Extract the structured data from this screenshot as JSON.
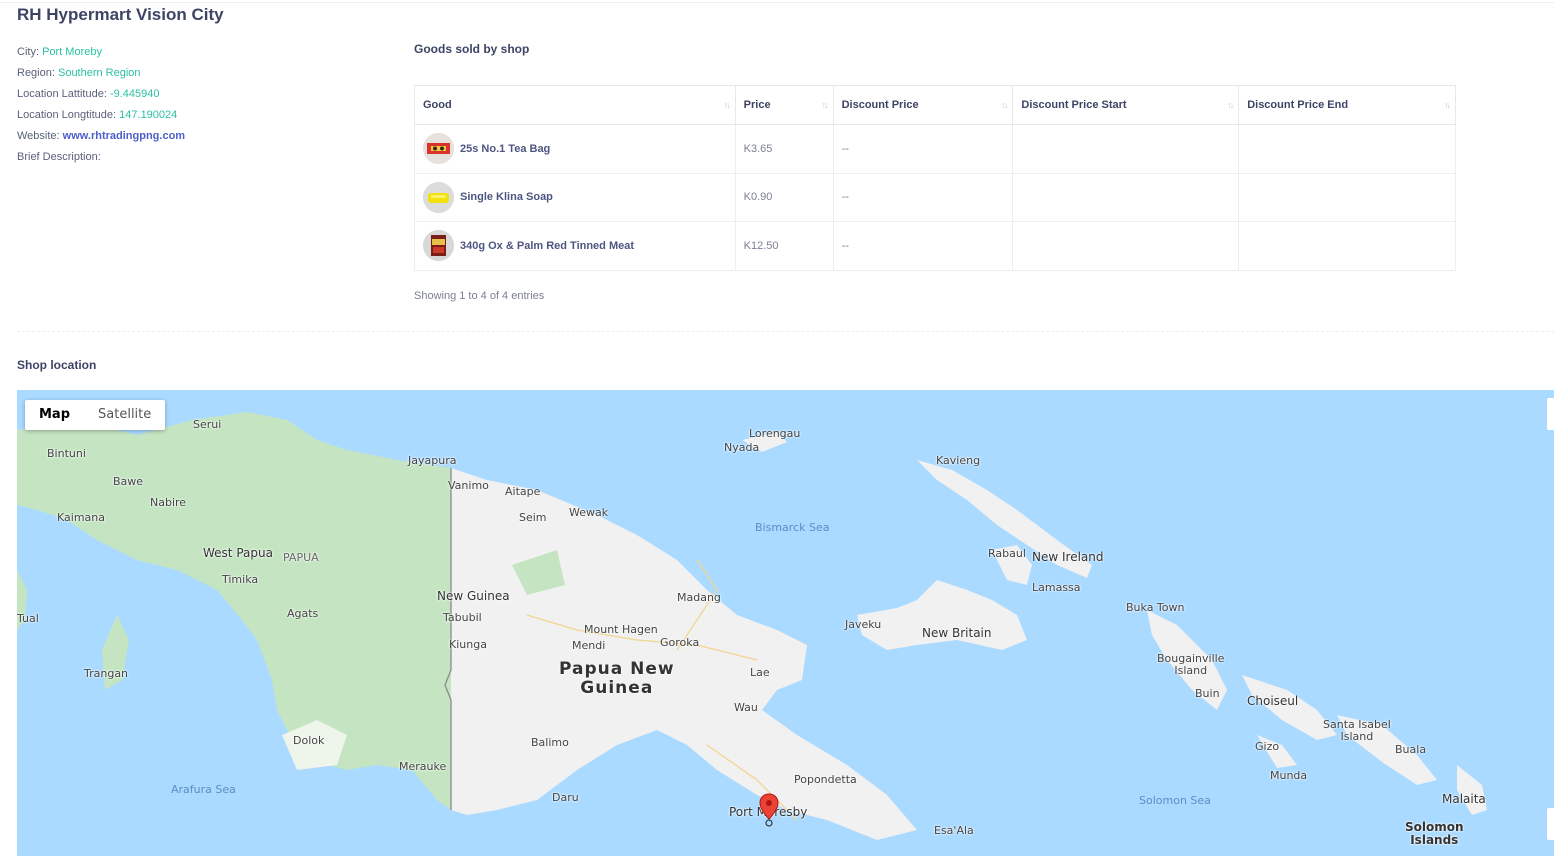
{
  "shop": {
    "title": "RH Hypermart Vision City",
    "city_label": "City:",
    "city": "Port Moreby",
    "region_label": "Region:",
    "region": "Southern Region",
    "lat_label": "Location Lattitude:",
    "lat": "-9.445940",
    "lng_label": "Location Longtitude:",
    "lng": "147.190024",
    "website_label": "Website:",
    "website": "www.rhtradingpng.com",
    "desc_label": "Brief Description:"
  },
  "goods": {
    "title": "Goods sold by shop",
    "columns": [
      "Good",
      "Price",
      "Discount Price",
      "Discount Price Start",
      "Discount Price End"
    ],
    "sort_icon": "sort-icon",
    "rows": [
      {
        "name": "25s No.1 Tea Bag",
        "price": "K3.65",
        "discount": "--",
        "start": "",
        "end": ""
      },
      {
        "name": "Single Klina Soap",
        "price": "K0.90",
        "discount": "--",
        "start": "",
        "end": ""
      },
      {
        "name": "340g Ox & Palm Red Tinned Meat",
        "price": "K12.50",
        "discount": "--",
        "start": "",
        "end": ""
      }
    ],
    "entries": "Showing 1 to 4 of 4 entries"
  },
  "location": {
    "title": "Shop location",
    "map_button": "Map",
    "satellite_button": "Satellite",
    "labels": {
      "serui": "Serui",
      "bintuni": "Bintuni",
      "bawe": "Bawe",
      "nabire": "Nabire",
      "kaimana": "Kaimana",
      "west_papua": "West Papua",
      "papua": "PAPUA",
      "timika": "Timika",
      "agats": "Agats",
      "tual": "Tual",
      "trangan": "Trangan",
      "dolok": "Dolok",
      "arafura": "Arafura Sea",
      "merauke": "Merauke",
      "jayapura": "Jayapura",
      "vanimo": "Vanimo",
      "aitape": "Aitape",
      "seim": "Seim",
      "wewak": "Wewak",
      "new_guinea": "New Guinea",
      "tabubil": "Tabubil",
      "kiunga": "Kiunga",
      "mendi": "Mendi",
      "mount_hagen": "Mount Hagen",
      "goroka": "Goroka",
      "madang": "Madang",
      "png": "Papua New\nGuinea",
      "lae": "Lae",
      "wau": "Wau",
      "balimo": "Balimo",
      "daru": "Daru",
      "popondetta": "Popondetta",
      "port_moresby": "Port Moresby",
      "lorengau": "Lorengau",
      "nyada": "Nyada",
      "bismarck": "Bismarck Sea",
      "kavieng": "Kavieng",
      "rabaul": "Rabaul",
      "new_ireland": "New Ireland",
      "lamassa": "Lamassa",
      "javeku": "Javeku",
      "new_britain": "New Britain",
      "buka": "Buka Town",
      "bougainville": "Bougainville\nIsland",
      "buin": "Buin",
      "choiseul": "Choiseul",
      "santa_isabel": "Santa Isabel\nIsland",
      "gizo": "Gizo",
      "munda": "Munda",
      "buala": "Buala",
      "solomon_sea": "Solomon Sea",
      "malaita": "Malaita",
      "solomon_islands": "Solomon\nIslands",
      "esa_ala": "Esa'Ala"
    }
  }
}
